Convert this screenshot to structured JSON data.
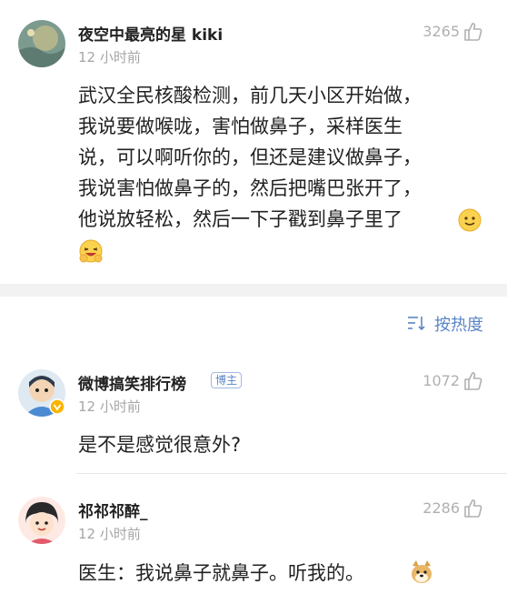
{
  "comment1": {
    "user": "夜空中最亮的星 kiki",
    "time": "12 小时前",
    "likes": "3265",
    "lines": [
      "武汉全民核酸检测，前几天小区开始做，",
      "我说要做喉咙，害怕做鼻子，采样医生",
      "说，可以啊听你的，但还是建议做鼻子，",
      "我说害怕做鼻子的，然后把嘴巴张开了，",
      "他说放轻松，然后一下子戳到鼻子里了"
    ],
    "emojis": [
      "smile-emoji",
      "laughing-emoji"
    ]
  },
  "sort": {
    "label": "按热度",
    "icon": "sort-icon"
  },
  "comment2": {
    "user": "微博搞笑排行榜",
    "badge": "博主",
    "time": "12 小时前",
    "likes": "1072",
    "text": "是不是感觉很意外?"
  },
  "comment3": {
    "user": "祁祁祁醉_",
    "time": "12 小时前",
    "likes": "2286",
    "text": "医生：我说鼻子就鼻子。听我的。",
    "emoji": "doge-emoji"
  },
  "colors": {
    "text": "#222222",
    "muted": "#a6a6a6",
    "link": "#5b85c5",
    "separator": "#f2f2f2"
  }
}
